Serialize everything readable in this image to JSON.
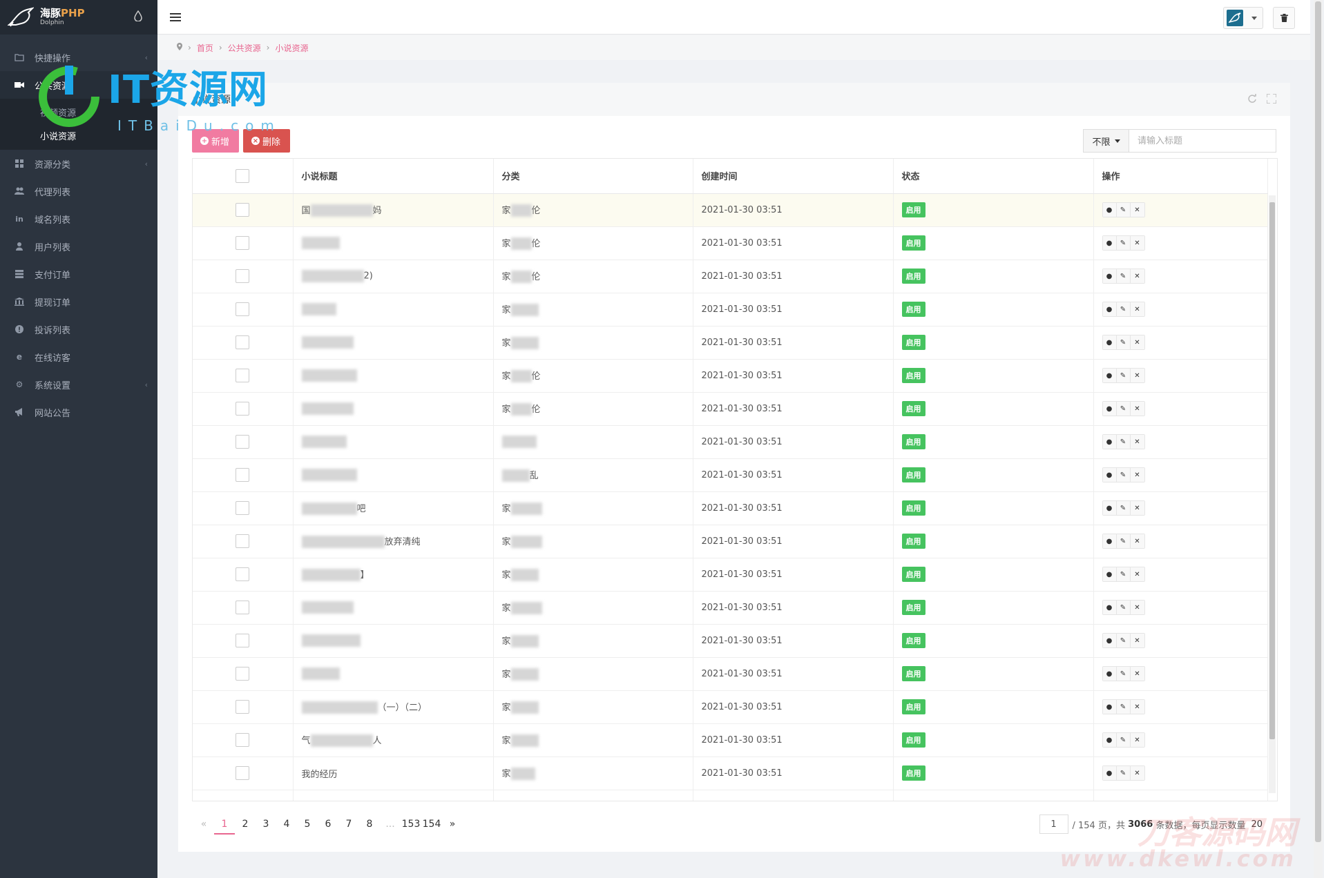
{
  "brand": {
    "name": "海豚",
    "name_suffix": "PHP",
    "sub": "Dolphin"
  },
  "breadcrumb": [
    "首页",
    "公共资源",
    "小说资源"
  ],
  "sidebar": {
    "items": [
      {
        "label": "快捷操作",
        "icon": "folder-icon",
        "has_children": true
      },
      {
        "label": "公共资源",
        "icon": "video-icon",
        "active": true,
        "children": [
          {
            "label": "视频资源"
          },
          {
            "label": "小说资源",
            "current": true
          }
        ]
      },
      {
        "label": "资源分类",
        "icon": "grid-icon",
        "has_children": true
      },
      {
        "label": "代理列表",
        "icon": "users-icon"
      },
      {
        "label": "域名列表",
        "icon": "linkedin-icon"
      },
      {
        "label": "用户列表",
        "icon": "user-icon"
      },
      {
        "label": "支付订单",
        "icon": "list-icon"
      },
      {
        "label": "提现订单",
        "icon": "bank-icon"
      },
      {
        "label": "投诉列表",
        "icon": "alert-icon"
      },
      {
        "label": "在线访客",
        "icon": "visitor-icon"
      },
      {
        "label": "系统设置",
        "icon": "gear-icon",
        "has_children": true
      },
      {
        "label": "网站公告",
        "icon": "bullhorn-icon"
      }
    ]
  },
  "panel": {
    "title": "小说资源"
  },
  "toolbar": {
    "add_label": "新增",
    "delete_label": "删除"
  },
  "search": {
    "filter_label": "不限",
    "placeholder": "请输入标题"
  },
  "table": {
    "headers": [
      "小说标题",
      "分类",
      "创建时间",
      "状态",
      "操作"
    ],
    "status_label": "启用",
    "rows": [
      {
        "title": "国",
        "title_tail": "妈",
        "category": "家",
        "cat_tail": "伦",
        "time": "2021-01-30 03:51"
      },
      {
        "title": "",
        "title_tail": "",
        "category": "家",
        "cat_tail": "伦",
        "time": "2021-01-30 03:51"
      },
      {
        "title": "",
        "title_tail": "2)",
        "category": "家",
        "cat_tail": "伦",
        "time": "2021-01-30 03:51"
      },
      {
        "title": "",
        "title_tail": "",
        "category": "家",
        "cat_tail": "",
        "time": "2021-01-30 03:51"
      },
      {
        "title": "",
        "title_tail": "",
        "category": "家",
        "cat_tail": "",
        "time": "2021-01-30 03:51"
      },
      {
        "title": "",
        "title_tail": "",
        "category": "家",
        "cat_tail": "伦",
        "time": "2021-01-30 03:51"
      },
      {
        "title": "",
        "title_tail": "",
        "category": "家",
        "cat_tail": "伦",
        "time": "2021-01-30 03:51"
      },
      {
        "title": "",
        "title_tail": "",
        "category": "",
        "cat_tail": "",
        "time": "2021-01-30 03:51"
      },
      {
        "title": "",
        "title_tail": "",
        "category": "",
        "cat_tail": "乱",
        "time": "2021-01-30 03:51"
      },
      {
        "title": "",
        "title_tail": "吧",
        "category": "家",
        "cat_tail": "",
        "time": "2021-01-30 03:51"
      },
      {
        "title": "",
        "title_tail": "放弃清纯",
        "category": "家",
        "cat_tail": "",
        "time": "2021-01-30 03:51"
      },
      {
        "title": "",
        "title_tail": "】",
        "category": "家",
        "cat_tail": "",
        "time": "2021-01-30 03:51"
      },
      {
        "title": "",
        "title_tail": "",
        "category": "家",
        "cat_tail": "",
        "time": "2021-01-30 03:51"
      },
      {
        "title": "",
        "title_tail": "",
        "category": "家",
        "cat_tail": "",
        "time": "2021-01-30 03:51"
      },
      {
        "title": "",
        "title_tail": "",
        "category": "家",
        "cat_tail": "",
        "time": "2021-01-30 03:51"
      },
      {
        "title": "",
        "title_tail": "（一）（二）",
        "category": "家",
        "cat_tail": "",
        "time": "2021-01-30 03:51"
      },
      {
        "title": "气",
        "title_tail": "人",
        "category": "家",
        "cat_tail": "",
        "time": "2021-01-30 03:51"
      },
      {
        "title": "我的经历",
        "title_tail": "",
        "category": "家",
        "cat_tail": "",
        "time": "2021-01-30 03:51"
      }
    ]
  },
  "pagination": {
    "prev": "«",
    "next": "»",
    "pages": [
      "1",
      "2",
      "3",
      "4",
      "5",
      "6",
      "7",
      "8",
      "...",
      "153",
      "154"
    ],
    "current": "1",
    "jump_value": "1",
    "total_pages_text": "/ 154 页，共",
    "total_count": "3066",
    "count_suffix": "条数据，每页显示数量",
    "per_page": "20"
  },
  "watermark": {
    "main": "IT资源网",
    "sub": "ITBaiDu.com",
    "corner": "刀客源码网",
    "corner_url": "www.dkewl.com"
  },
  "colors": {
    "sidebar_bg": "#2c343f",
    "accent_pink": "#e8658f",
    "add_btn": "#f17ba1",
    "delete_btn": "#d9534f",
    "status_green": "#46c35f"
  }
}
